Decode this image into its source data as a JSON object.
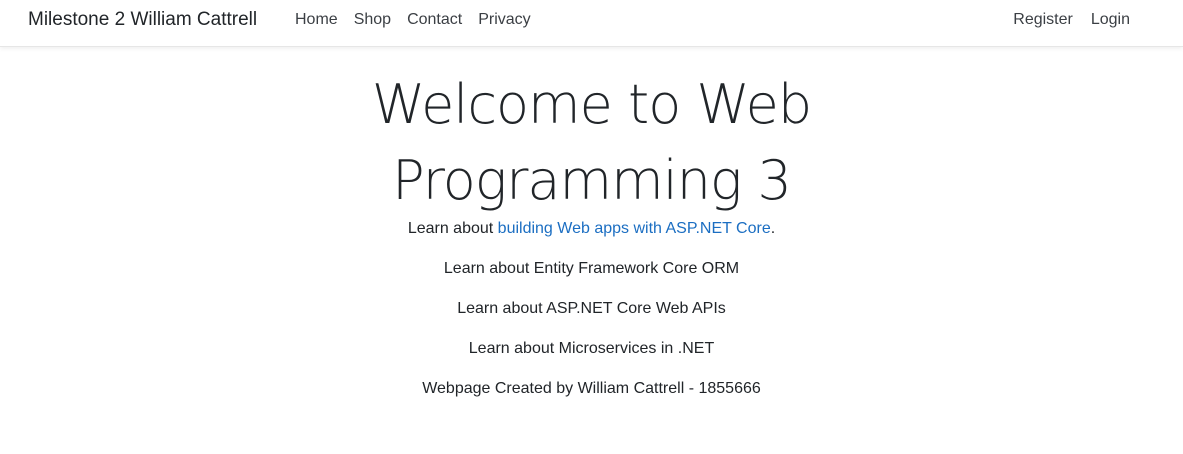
{
  "navbar": {
    "brand": "Milestone 2 William Cattrell",
    "left_links": [
      "Home",
      "Shop",
      "Contact",
      "Privacy"
    ],
    "right_links": [
      "Register",
      "Login"
    ]
  },
  "main": {
    "heading": "Welcome to Web Programming 3",
    "learn_prefix": "Learn about ",
    "learn_link": "building Web apps with ASP.NET Core",
    "learn_suffix": ".",
    "lines": [
      "Learn about Entity Framework Core ORM",
      "Learn about ASP.NET Core Web APIs",
      "Learn about Microservices in .NET",
      "Webpage Created by William Cattrell - 1855666"
    ]
  },
  "colors": {
    "link": "#1b6ec2",
    "text": "#212529"
  }
}
